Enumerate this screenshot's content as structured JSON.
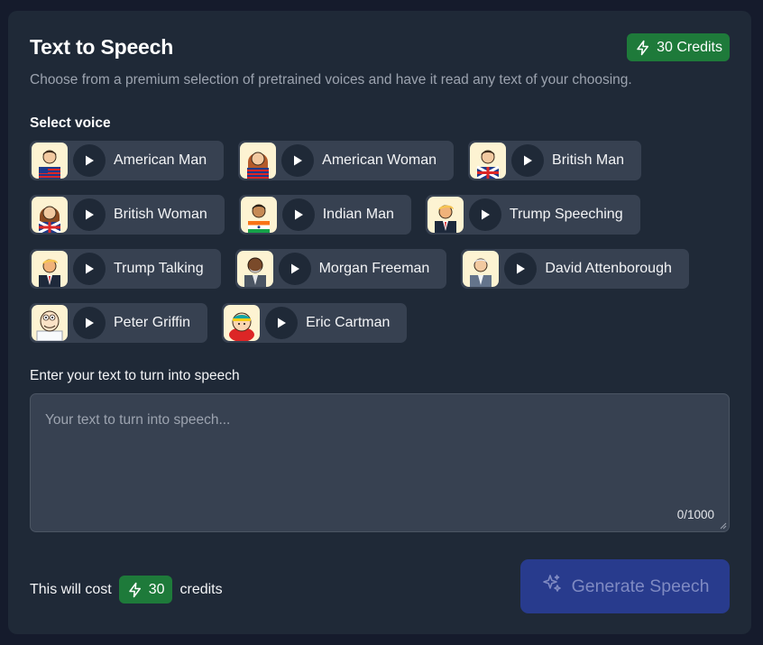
{
  "header": {
    "title": "Text to Speech",
    "credits_label": "30 Credits",
    "subtitle": "Choose from a premium selection of pretrained voices and have it read any text of your choosing."
  },
  "voices": {
    "label": "Select voice",
    "items": [
      {
        "name": "American Man",
        "avatar": "american-man-avatar"
      },
      {
        "name": "American Woman",
        "avatar": "american-woman-avatar"
      },
      {
        "name": "British Man",
        "avatar": "british-man-avatar"
      },
      {
        "name": "British Woman",
        "avatar": "british-woman-avatar"
      },
      {
        "name": "Indian Man",
        "avatar": "indian-man-avatar"
      },
      {
        "name": "Trump Speeching",
        "avatar": "trump-avatar"
      },
      {
        "name": "Trump Talking",
        "avatar": "trump-avatar"
      },
      {
        "name": "Morgan Freeman",
        "avatar": "morgan-freeman-avatar"
      },
      {
        "name": "David Attenborough",
        "avatar": "david-attenborough-avatar"
      },
      {
        "name": "Peter Griffin",
        "avatar": "peter-griffin-avatar"
      },
      {
        "name": "Eric Cartman",
        "avatar": "eric-cartman-avatar"
      }
    ]
  },
  "text_input": {
    "label": "Enter your text to turn into speech",
    "placeholder": "Your text to turn into speech...",
    "value": "",
    "counter": "0/1000"
  },
  "footer": {
    "cost_prefix": "This will cost",
    "cost_amount": "30",
    "cost_suffix": "credits",
    "generate_label": "Generate Speech"
  },
  "icons": {
    "credits": "lightning-bolt-icon",
    "play": "play-icon",
    "generate": "sparkles-icon"
  },
  "colors": {
    "background": "#151b2c",
    "card": "#1f2937",
    "chip": "#374151",
    "credit_badge": "#1e7a3a",
    "generate_button": "#283b8d",
    "generate_text": "#7f8ac2",
    "muted_text": "#9ca3af"
  }
}
